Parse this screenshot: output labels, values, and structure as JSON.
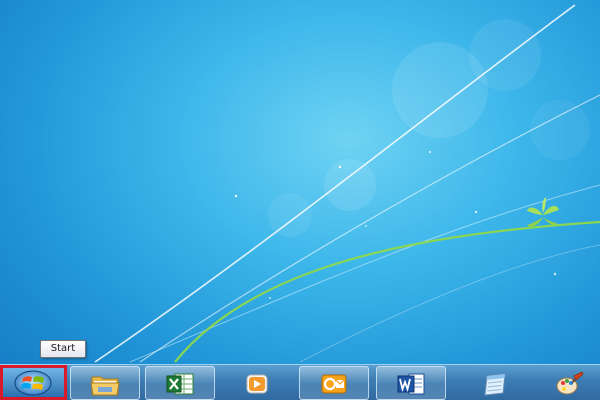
{
  "tooltip": {
    "text": "Start"
  },
  "taskbar": {
    "start_button": {
      "icon": "windows-logo-icon",
      "highlight_color": "#d91a2a"
    },
    "pinned_apps": [
      {
        "icon": "folder-icon"
      },
      {
        "icon": "excel-icon"
      },
      {
        "icon": "media-player-icon"
      },
      {
        "icon": "outlook-icon"
      },
      {
        "icon": "word-icon"
      },
      {
        "icon": "notepad-icon"
      },
      {
        "icon": "paint-icon"
      }
    ]
  },
  "colors": {
    "desktop_background": "#2aa3e3",
    "taskbar": "#3f7fb5",
    "start_highlight": "#d91a2a"
  }
}
